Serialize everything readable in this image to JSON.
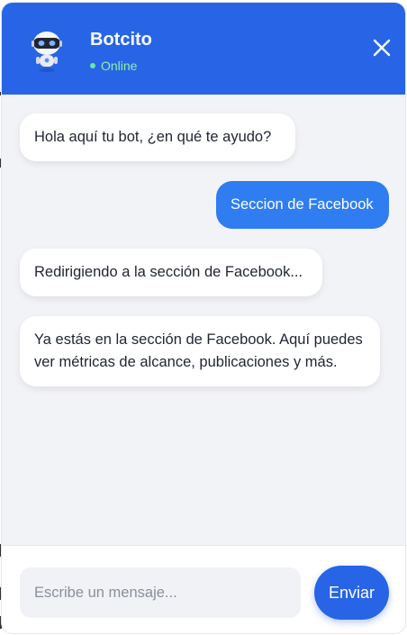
{
  "header": {
    "bot_name": "Botcito",
    "status": "Online",
    "avatar_icon": "robot-icon",
    "close_icon": "close-icon",
    "background_color": "#2765e6",
    "status_color": "#8ef0b0"
  },
  "messages": [
    {
      "sender": "bot",
      "text": "Hola aquí tu bot, ¿en qué te ayudo?"
    },
    {
      "sender": "user",
      "text": "Seccion de Facebook"
    },
    {
      "sender": "bot",
      "text": "Redirigiendo a la sección de Facebook..."
    },
    {
      "sender": "bot",
      "text": "Ya estás en la sección de Facebook. Aquí puedes ver métricas de alcance, publicaciones y más."
    }
  ],
  "input": {
    "placeholder": "Escribe un mensaje...",
    "value": ""
  },
  "send_button": {
    "label": "Enviar",
    "color": "#2765e6"
  },
  "colors": {
    "user_bubble": "#2f7df0",
    "bot_bubble": "#ffffff",
    "chat_background": "#f2f3f6"
  }
}
